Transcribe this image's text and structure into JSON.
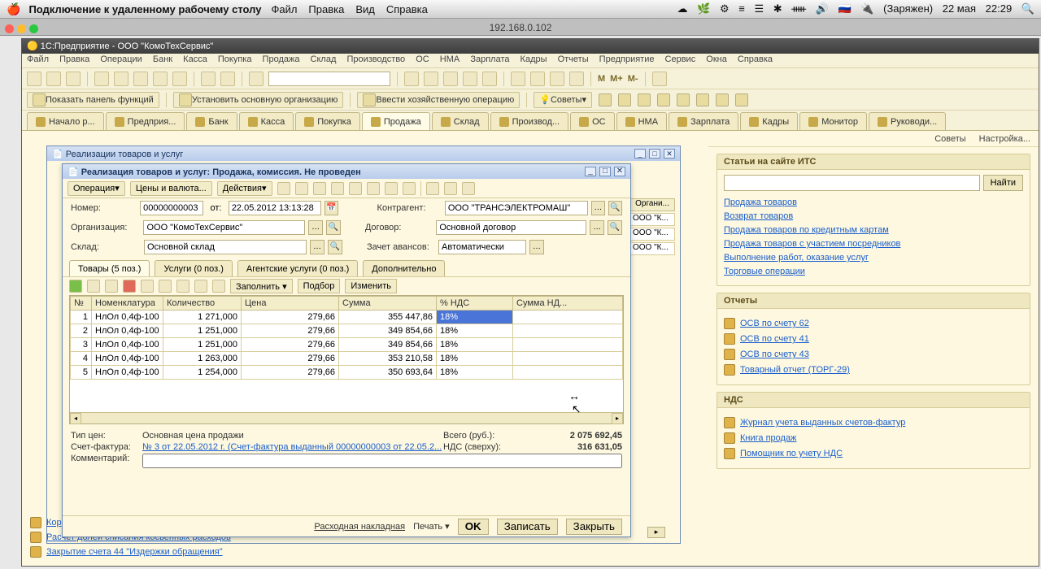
{
  "mac": {
    "app": "Подключение к удаленному рабочему столу",
    "menus": [
      "Файл",
      "Правка",
      "Вид",
      "Справка"
    ],
    "tray": [
      "☁",
      "🌿",
      "⚙",
      "≡",
      "☰",
      "✱",
      "ᚔ",
      "🔊",
      "🇷🇺",
      "🔌",
      "(Заряжен)",
      "22 мая",
      "22:29"
    ],
    "conn_title": "192.168.0.102"
  },
  "onec": {
    "title": "1С:Предприятие - ООО \"КомоТехСервис\"",
    "menu": [
      "Файл",
      "Правка",
      "Операции",
      "Банк",
      "Касса",
      "Покупка",
      "Продажа",
      "Склад",
      "Производство",
      "ОС",
      "НМА",
      "Зарплата",
      "Кадры",
      "Отчеты",
      "Предприятие",
      "Сервис",
      "Окна",
      "Справка"
    ],
    "toolbar_m": [
      "M",
      "M+",
      "M-"
    ],
    "toolbar2": {
      "show_panel": "Показать панель функций",
      "set_org": "Установить основную организацию",
      "enter_op": "Ввести хозяйственную операцию",
      "tips": "Советы"
    },
    "tabs": [
      "Начало р...",
      "Предприя...",
      "Банк",
      "Касса",
      "Покупка",
      "Продажа",
      "Склад",
      "Производ...",
      "ОС",
      "НМА",
      "Зарплата",
      "Кадры",
      "Монитор",
      "Руководи..."
    ],
    "active_tab": 5
  },
  "rightbar": {
    "tips": "Советы",
    "settings": "Настройка...",
    "panel_its": {
      "title": "Статьи на сайте ИТС",
      "find": "Найти",
      "links": [
        "Продажа товаров",
        "Возврат товаров",
        "Продажа товаров по кредитным картам",
        "Продажа товаров с участием посредников",
        "Выполнение работ, оказание услуг",
        "Торговые операции"
      ]
    },
    "panel_reports": {
      "title": "Отчеты",
      "items": [
        "ОСВ по счету 62",
        "ОСВ по счету 41",
        "ОСВ по счету 43",
        "Товарный отчет (ТОРГ-29)"
      ]
    },
    "panel_vat": {
      "title": "НДС",
      "items": [
        "Журнал учета выданных счетов-фактур",
        "Книга продаж",
        "Помощник по учету НДС"
      ]
    }
  },
  "bg_window": {
    "title": "Реализации товаров и услуг",
    "col": "Органи...",
    "vals": [
      "ООО \"К...",
      "ООО \"К...",
      "ООО \"К..."
    ]
  },
  "bottom_links": [
    "Корректировка стоимости списанных товаров",
    "Расчет долей списания косвенных расходов",
    "Закрытие счета 44 \"Издержки обращения\""
  ],
  "dialog": {
    "title": "Реализация товаров и услуг: Продажа, комиссия. Не проведен",
    "toolbar": {
      "operation": "Операция",
      "prices": "Цены и валюта...",
      "actions": "Действия"
    },
    "labels": {
      "number": "Номер:",
      "from": "от:",
      "org": "Организация:",
      "warehouse": "Склад:",
      "contragent": "Контрагент:",
      "contract": "Договор:",
      "advance": "Зачет авансов:"
    },
    "values": {
      "number": "00000000003",
      "date": "22.05.2012 13:13:28",
      "org": "ООО \"КомоТехСервис\"",
      "warehouse": "Основной склад",
      "contragent": "ООО \"ТРАНСЭЛЕКТРОМАШ\"",
      "contract": "Основной договор",
      "advance": "Автоматически"
    },
    "tabs": [
      "Товары (5 поз.)",
      "Услуги (0 поз.)",
      "Агентские услуги (0 поз.)",
      "Дополнительно"
    ],
    "grid_toolbar": {
      "fill": "Заполнить",
      "select": "Подбор",
      "change": "Изменить"
    },
    "columns": [
      "№",
      "Номенклатура",
      "Количество",
      "Цена",
      "Сумма",
      "% НДС",
      "Сумма НД..."
    ],
    "rows": [
      {
        "n": "1",
        "nom": "НлОл 0,4ф-100",
        "qty": "1 271,000",
        "price": "279,66",
        "sum": "355 447,86",
        "nds": "18%"
      },
      {
        "n": "2",
        "nom": "НлОл 0,4ф-100",
        "qty": "1 251,000",
        "price": "279,66",
        "sum": "349 854,66",
        "nds": "18%"
      },
      {
        "n": "3",
        "nom": "НлОл 0,4ф-100",
        "qty": "1 251,000",
        "price": "279,66",
        "sum": "349 854,66",
        "nds": "18%"
      },
      {
        "n": "4",
        "nom": "НлОл 0,4ф-100",
        "qty": "1 263,000",
        "price": "279,66",
        "sum": "353 210,58",
        "nds": "18%"
      },
      {
        "n": "5",
        "nom": "НлОл 0,4ф-100",
        "qty": "1 254,000",
        "price": "279,66",
        "sum": "350 693,64",
        "nds": "18%"
      }
    ],
    "totals": {
      "price_type_lbl": "Тип цен:",
      "price_type": "Основная цена продажи",
      "invoice_lbl": "Счет-фактура:",
      "invoice": "№ 3 от 22.05.2012 г. (Счет-фактура выданный 00000000003 от 22.05.2...",
      "comment_lbl": "Комментарий:",
      "total_lbl": "Всего (руб.):",
      "total": "2 075 692,45",
      "vat_lbl": "НДС (сверху):",
      "vat": "316 631,05"
    },
    "footer": {
      "waybill": "Расходная накладная",
      "print": "Печать",
      "ok": "OK",
      "write": "Записать",
      "close": "Закрыть"
    }
  }
}
